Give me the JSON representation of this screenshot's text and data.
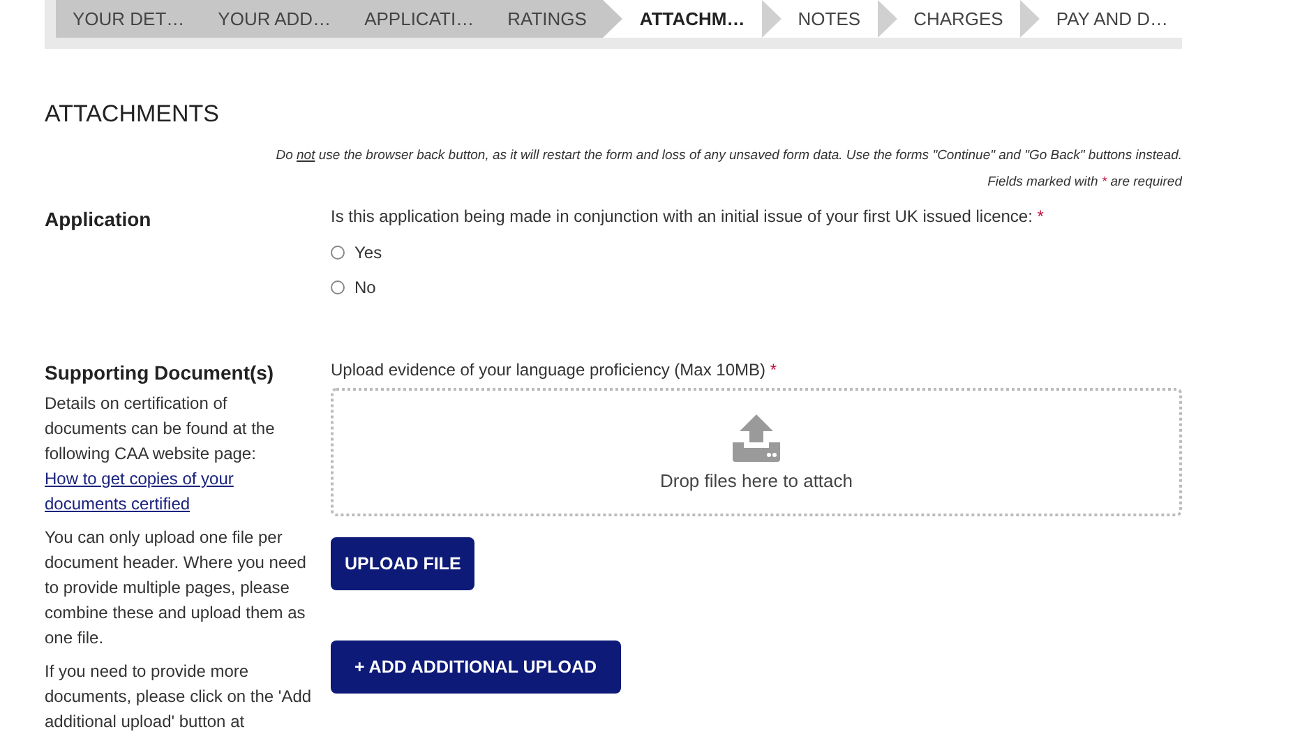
{
  "steps": [
    {
      "label": "YOUR DET…",
      "completed": true,
      "selected": false
    },
    {
      "label": "YOUR ADD…",
      "completed": true,
      "selected": false
    },
    {
      "label": "APPLICATI…",
      "completed": true,
      "selected": false
    },
    {
      "label": "RATINGS",
      "completed": true,
      "selected": false
    },
    {
      "label": "ATTACHM…",
      "completed": false,
      "selected": true
    },
    {
      "label": "NOTES",
      "completed": false,
      "selected": false
    },
    {
      "label": "CHARGES",
      "completed": false,
      "selected": false
    },
    {
      "label": "PAY AND D…",
      "completed": false,
      "selected": false
    }
  ],
  "heading": "ATTACHMENTS",
  "notice": {
    "before": "Do ",
    "underlined": "not",
    "after": " use the browser back button, as it will restart the form and loss of any unsaved form data. Use the forms \"Continue\" and \"Go Back\" buttons instead."
  },
  "required_note": {
    "before": "Fields marked with ",
    "mark": "*",
    "after": " are required"
  },
  "application": {
    "label": "Application",
    "question": "Is this application being made in conjunction with an initial issue of your first UK issued licence:",
    "required": true,
    "options": [
      {
        "label": "Yes",
        "selected": false
      },
      {
        "label": "No",
        "selected": false
      }
    ]
  },
  "supporting": {
    "label": "Supporting Document(s)",
    "details": {
      "text": "Details on certification of documents can be found at the following CAA website page: ",
      "link": "How to get copies of your documents certified"
    },
    "paragraphs": [
      "You can only upload one file per document header. Where you need to provide multiple pages, please combine these and upload them as one file.",
      "If you need to provide more documents, please click on the 'Add additional upload' button at"
    ],
    "upload_label": "Upload evidence of your language proficiency (Max 10MB)",
    "upload_required": true,
    "drop_text": "Drop files here to attach",
    "upload_button": "UPLOAD FILE",
    "add_button": "+ ADD ADDITIONAL UPLOAD"
  }
}
